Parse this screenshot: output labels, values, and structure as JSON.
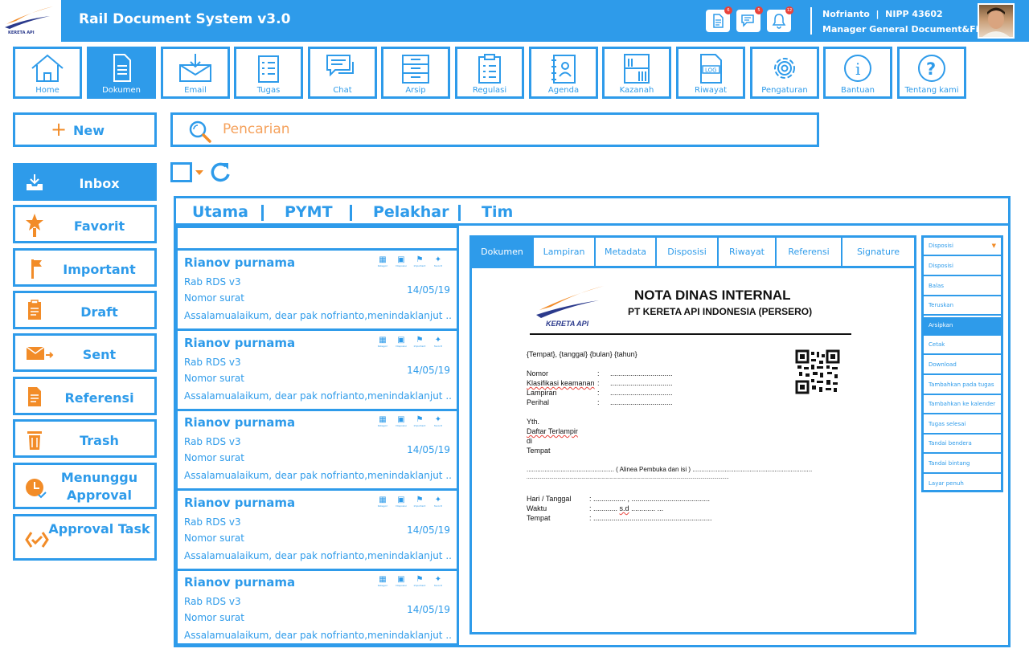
{
  "header": {
    "logo_text": "KERETA API",
    "title": "Rail Document System v3.0",
    "icons": [
      {
        "name": "document-notification-icon",
        "badge": "6"
      },
      {
        "name": "chat-notification-icon",
        "badge": "5"
      },
      {
        "name": "bell-icon",
        "badge": "12"
      }
    ],
    "user_name": "Nofrianto",
    "user_nipp": "NIPP 43602",
    "user_role": "Manager General Document&Files"
  },
  "nav": [
    {
      "label": "Home",
      "icon": "home-icon"
    },
    {
      "label": "Dokumen",
      "icon": "document-icon"
    },
    {
      "label": "Email",
      "icon": "email-icon"
    },
    {
      "label": "Tugas",
      "icon": "task-list-icon"
    },
    {
      "label": "Chat",
      "icon": "chat-icon"
    },
    {
      "label": "Arsip",
      "icon": "archive-cabinet-icon"
    },
    {
      "label": "Regulasi",
      "icon": "clipboard-icon"
    },
    {
      "label": "Agenda",
      "icon": "agenda-book-icon"
    },
    {
      "label": "Kazanah",
      "icon": "bookshelf-icon"
    },
    {
      "label": "Riwayat",
      "icon": "log-file-icon"
    },
    {
      "label": "Pengaturan",
      "icon": "gear-icon"
    },
    {
      "label": "Bantuan",
      "icon": "info-icon"
    },
    {
      "label": "Tentang kami",
      "icon": "question-icon"
    }
  ],
  "new_label": "New",
  "search": {
    "placeholder": "Pencarian"
  },
  "sidebar": [
    {
      "label": "Inbox",
      "icon": "inbox-icon"
    },
    {
      "label": "Favorit",
      "icon": "star-icon"
    },
    {
      "label": "Important",
      "icon": "flag-icon"
    },
    {
      "label": "Draft",
      "icon": "clipboard-draft-icon"
    },
    {
      "label": "Sent",
      "icon": "sent-mail-icon"
    },
    {
      "label": "Referensi",
      "icon": "reference-doc-icon"
    },
    {
      "label": "Trash",
      "icon": "trash-icon"
    },
    {
      "label": "Menunggu Approval",
      "icon": "clock-check-icon"
    },
    {
      "label": "Approval Task",
      "icon": "approval-task-icon"
    }
  ],
  "main_tabs": [
    "Utama",
    "PYMT",
    "Pelakhar",
    "Tim"
  ],
  "message_actions": [
    "Kategori",
    "Disposisi",
    "Important",
    "favorit"
  ],
  "messages": [
    {
      "sender": "Rianov purnama",
      "subject": "Rab RDS v3",
      "type": "Nomor surat",
      "date": "14/05/19",
      "preview": "Assalamualaikum, dear pak nofrianto,menindaklanjut ....."
    },
    {
      "sender": "Rianov purnama",
      "subject": "Rab RDS v3",
      "type": "Nomor surat",
      "date": "14/05/19",
      "preview": "Assalamualaikum, dear pak nofrianto,menindaklanjut ....."
    },
    {
      "sender": "Rianov purnama",
      "subject": "Rab RDS v3",
      "type": "Nomor surat",
      "date": "14/05/19",
      "preview": "Assalamualaikum, dear pak nofrianto,menindaklanjut ....."
    },
    {
      "sender": "Rianov purnama",
      "subject": "Rab RDS v3",
      "type": "Nomor surat",
      "date": "14/05/19",
      "preview": "Assalamualaikum, dear pak nofrianto,menindaklanjut ....."
    },
    {
      "sender": "Rianov purnama",
      "subject": "Rab RDS v3",
      "type": "Nomor surat",
      "date": "14/05/19",
      "preview": "Assalamualaikum, dear pak nofrianto,menindaklanjut ....."
    }
  ],
  "doc_tabs": [
    "Dokumen",
    "Lampiran",
    "Metadata",
    "Disposisi",
    "Riwayat",
    "Referensi",
    "Signature"
  ],
  "document": {
    "logo_text": "KERETA API",
    "title": "NOTA DINAS INTERNAL",
    "company": "PT KERETA API INDONESIA (PERSERO)",
    "place_date": "{Tempat}, {tanggal} {bulan} {tahun}",
    "fields": [
      {
        "label": "Nomor",
        "sep": ":",
        "value": "..............................."
      },
      {
        "label": "Klasifikasi keamanan",
        "sep": ":",
        "value": "..............................."
      },
      {
        "label": "Lampiran",
        "sep": ":",
        "value": "..............................."
      },
      {
        "label": "Perihal",
        "sep": ":",
        "value": "..............................."
      }
    ],
    "yth": "Yth.",
    "recipient": "Daftar Terlampir",
    "di": "di",
    "tempat": "Tempat",
    "body_line": "................................................. ( Alinea Pembuka dan isi ) ...................................................................",
    "body_line2": ".......................................................................................................................................................",
    "schedule": [
      {
        "label": "Hari / Tanggal",
        "value": ": ................ , .......................................",
        "emph": ""
      },
      {
        "label": "Waktu",
        "value": ": ............",
        "emph": "s.d",
        "value2": "............ ..."
      },
      {
        "label": "Tempat",
        "value": ": ...........................................................",
        "emph": ""
      }
    ]
  },
  "action_panel": {
    "dropdown": "Disposisi",
    "items": [
      "Disposisi",
      "Balas",
      "Teruskan",
      "Arsipkan",
      "Cetak",
      "Download",
      "Tambahkan pada tugas",
      "Tambahkan ke kalender",
      "Tugas selesai",
      "Tandai bendera",
      "Tandai bintang",
      "Layar penuh"
    ],
    "active": "Arsipkan"
  },
  "colors": {
    "primary": "#2e9bea",
    "accent": "#f28c28",
    "badge": "#e8433b"
  }
}
